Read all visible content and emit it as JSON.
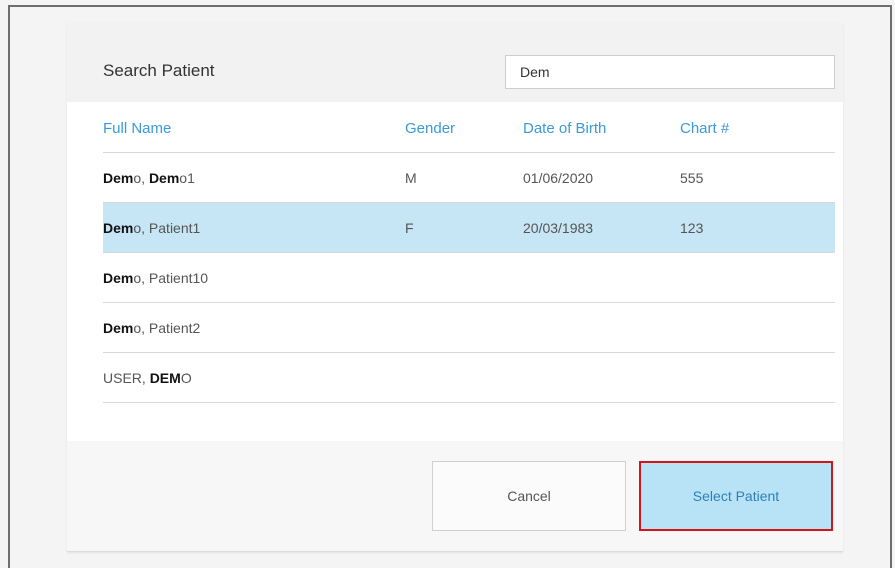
{
  "dialog": {
    "title": "Search Patient",
    "search_value": "Dem"
  },
  "table": {
    "headers": {
      "full_name": "Full Name",
      "gender": "Gender",
      "dob": "Date of Birth",
      "chart": "Chart #"
    },
    "rows": [
      {
        "name_parts": [
          {
            "t": "Dem",
            "b": true
          },
          {
            "t": "o, ",
            "b": false
          },
          {
            "t": "Dem",
            "b": true
          },
          {
            "t": "o1",
            "b": false
          }
        ],
        "gender": "M",
        "dob": "01/06/2020",
        "chart": "555",
        "selected": false
      },
      {
        "name_parts": [
          {
            "t": "Dem",
            "b": true
          },
          {
            "t": "o, Patient1",
            "b": false
          }
        ],
        "gender": "F",
        "dob": "20/03/1983",
        "chart": "123",
        "selected": true
      },
      {
        "name_parts": [
          {
            "t": "Dem",
            "b": true
          },
          {
            "t": "o, Patient10",
            "b": false
          }
        ],
        "gender": "",
        "dob": "",
        "chart": "",
        "selected": false
      },
      {
        "name_parts": [
          {
            "t": "Dem",
            "b": true
          },
          {
            "t": "o, Patient2",
            "b": false
          }
        ],
        "gender": "",
        "dob": "",
        "chart": "",
        "selected": false
      },
      {
        "name_parts": [
          {
            "t": "USER, ",
            "b": false
          },
          {
            "t": "DEM",
            "b": true
          },
          {
            "t": "O",
            "b": false
          }
        ],
        "gender": "",
        "dob": "",
        "chart": "",
        "selected": false
      }
    ]
  },
  "footer": {
    "cancel_label": "Cancel",
    "select_label": "Select Patient"
  },
  "colors": {
    "accent": "#3a9ad9",
    "selected_row": "#c6e6f6",
    "select_button_bg": "#b8e3f7",
    "highlight_border": "#d2141c"
  }
}
